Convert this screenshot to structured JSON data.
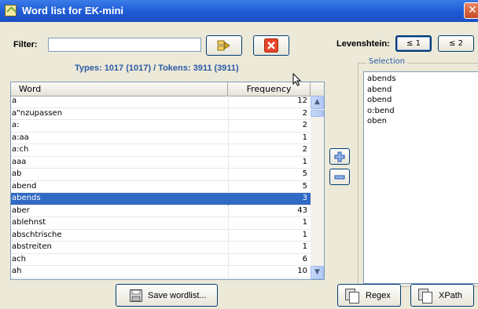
{
  "window": {
    "title": "Word list for EK-mini",
    "close_symbol": "✕"
  },
  "filter": {
    "label": "Filter:",
    "value": "",
    "placeholder": ""
  },
  "levenshtein": {
    "label": "Levenshtein:",
    "options": [
      "≤ 1",
      "≤ 2"
    ],
    "selected": "≤ 1"
  },
  "stats": "Types: 1017 (1017) / Tokens: 3911 (3911)",
  "table": {
    "columns": [
      "Word",
      "Frequency"
    ],
    "rows": [
      {
        "word": "a",
        "frequency": "12"
      },
      {
        "word": "a\"nzupassen",
        "frequency": "2"
      },
      {
        "word": "a:",
        "frequency": "2"
      },
      {
        "word": "a:aa",
        "frequency": "1"
      },
      {
        "word": "a:ch",
        "frequency": "2"
      },
      {
        "word": "aaa",
        "frequency": "1"
      },
      {
        "word": "ab",
        "frequency": "5"
      },
      {
        "word": "abend",
        "frequency": "5"
      },
      {
        "word": "abends",
        "frequency": "3",
        "selected": true
      },
      {
        "word": "aber",
        "frequency": "43"
      },
      {
        "word": "ablehnst",
        "frequency": "1"
      },
      {
        "word": "abschtrische",
        "frequency": "1"
      },
      {
        "word": "abstreiten",
        "frequency": "1"
      },
      {
        "word": "ach",
        "frequency": "6"
      },
      {
        "word": "ah",
        "frequency": "10"
      }
    ]
  },
  "selection": {
    "title": "Selection",
    "items": [
      "abends",
      "abend",
      "obend",
      "o:bend",
      "oben"
    ]
  },
  "buttons": {
    "save_wordlist": "Save wordlist...",
    "regex": "Regex",
    "xpath": "XPath",
    "add_symbol": "+",
    "remove_symbol": "−"
  },
  "colors": {
    "titlebar": "#1f5ad4",
    "selection_row": "#316ac5",
    "stats_text": "#2b5aa4"
  }
}
